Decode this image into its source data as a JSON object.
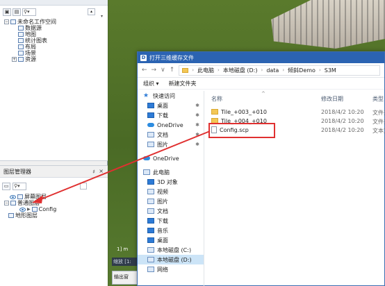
{
  "workspace": {
    "tree": [
      {
        "label": "未命名工作空间",
        "depth": 0,
        "expander": "−"
      },
      {
        "label": "数据源",
        "depth": 1
      },
      {
        "label": "地图",
        "depth": 1
      },
      {
        "label": "统计图表",
        "depth": 1
      },
      {
        "label": "布局",
        "depth": 1
      },
      {
        "label": "场景",
        "depth": 1
      },
      {
        "label": "资源",
        "depth": 1,
        "expander": "+"
      }
    ]
  },
  "layer_manager": {
    "title": "图层管理器",
    "pin": "♯",
    "close": "×",
    "items": [
      {
        "label": "屏幕图层"
      },
      {
        "label": "普通图层"
      },
      {
        "label": "Config"
      },
      {
        "label": "地形图层"
      }
    ]
  },
  "map": {
    "scale_text": "1] m",
    "status_text": "缩放 [1:",
    "output_label": "输出窗"
  },
  "dialog": {
    "title": "打开三维缓存文件",
    "path": [
      "此电脑",
      "本地磁盘 (D:)",
      "data",
      "倾斜Demo",
      "S3M"
    ],
    "toolbar": {
      "organize": "组织 ▾",
      "new_folder": "新建文件夹"
    },
    "nav": [
      {
        "label": "快速访问",
        "icon": "star-icon",
        "header": true
      },
      {
        "label": "桌面",
        "icon": "desktop-icon",
        "pin": true
      },
      {
        "label": "下载",
        "icon": "download-icon",
        "pin": true
      },
      {
        "label": "OneDrive",
        "icon": "cloud-icon",
        "pin": true
      },
      {
        "label": "文档",
        "icon": "document-icon",
        "pin": true
      },
      {
        "label": "图片",
        "icon": "picture-icon",
        "pin": true
      },
      {
        "label": "OneDrive",
        "icon": "cloud-icon",
        "header": true
      },
      {
        "label": "此电脑",
        "icon": "computer-icon",
        "header": true
      },
      {
        "label": "3D 对象",
        "icon": "cube-icon"
      },
      {
        "label": "视频",
        "icon": "video-icon"
      },
      {
        "label": "图片",
        "icon": "picture-icon"
      },
      {
        "label": "文档",
        "icon": "document-icon"
      },
      {
        "label": "下载",
        "icon": "download-icon"
      },
      {
        "label": "音乐",
        "icon": "music-icon"
      },
      {
        "label": "桌面",
        "icon": "desktop-icon"
      },
      {
        "label": "本地磁盘 (C:)",
        "icon": "drive-icon"
      },
      {
        "label": "本地磁盘 (D:)",
        "icon": "drive-icon",
        "selected": true
      },
      {
        "label": "网络",
        "icon": "network-icon"
      }
    ],
    "columns": {
      "name": "名称",
      "date": "修改日期",
      "type": "类型"
    },
    "files": [
      {
        "name": "Tile_+003_+010",
        "date": "2018/4/2 10:20",
        "type": "文件夹",
        "kind": "folder"
      },
      {
        "name": "Tile_+004_+010",
        "date": "2018/4/2 10:20",
        "type": "文件夹",
        "kind": "folder"
      },
      {
        "name": "Config.scp",
        "date": "2018/4/2 10:20",
        "type": "文本文",
        "kind": "file"
      }
    ]
  },
  "colors": {
    "title_bar": "#2b63b2",
    "highlight": "#e03030",
    "map": "#4c6b2a"
  }
}
